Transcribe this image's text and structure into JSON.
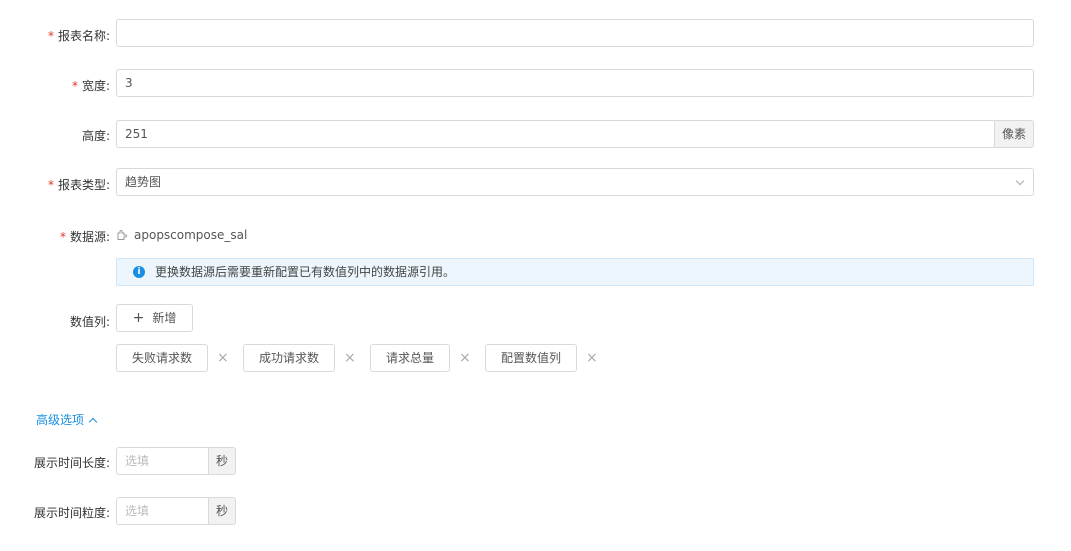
{
  "form": {
    "report_name": {
      "label": "报表名称:",
      "value": ""
    },
    "width": {
      "label": "宽度:",
      "value": "3"
    },
    "height": {
      "label": "高度:",
      "value": "251",
      "unit": "像素"
    },
    "report_type": {
      "label": "报表类型:",
      "value": "趋势图"
    },
    "datasource": {
      "label": "数据源:",
      "value": "apopscompose_sal",
      "icon": "plugin-icon"
    },
    "alert": {
      "text": "更换数据源后需要重新配置已有数值列中的数据源引用。",
      "icon": "info-icon"
    },
    "value_columns": {
      "label": "数值列:",
      "add_label": "新增",
      "tags": [
        "失败请求数",
        "成功请求数",
        "请求总量",
        "配置数值列"
      ]
    }
  },
  "advanced": {
    "toggle_label": "高级选项",
    "display_length": {
      "label": "展示时间长度:",
      "placeholder": "选填",
      "unit": "秒"
    },
    "display_granularity": {
      "label": "展示时间粒度:",
      "placeholder": "选填",
      "unit": "秒"
    }
  },
  "colors": {
    "accent": "#1a8fe3",
    "required": "#e5322d"
  }
}
